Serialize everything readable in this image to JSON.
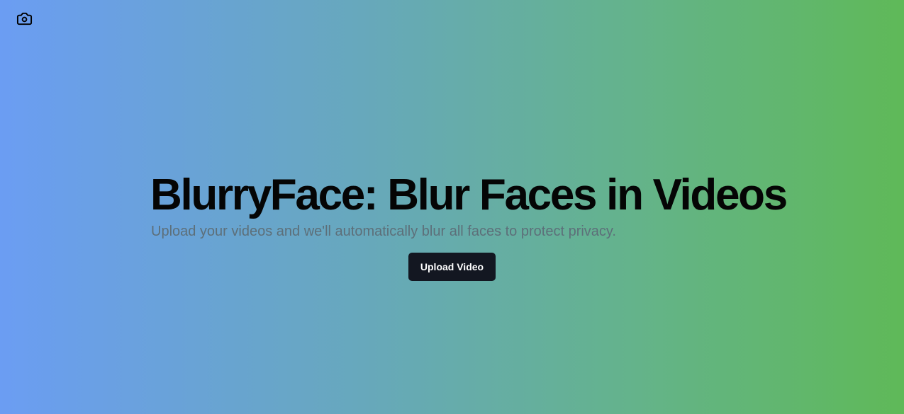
{
  "header": {
    "logo_icon": "camera-icon"
  },
  "hero": {
    "title": "BlurryFace: Blur Faces in Videos",
    "subtitle": "Upload your videos and we'll automatically blur all faces to protect privacy.",
    "upload_button_label": "Upload Video"
  },
  "colors": {
    "gradient_start": "#6b9df3",
    "gradient_end": "#5fb958",
    "title_text": "#050505",
    "subtitle_text": "#5d6f79",
    "button_background": "#131721",
    "button_text": "#ffffff"
  }
}
